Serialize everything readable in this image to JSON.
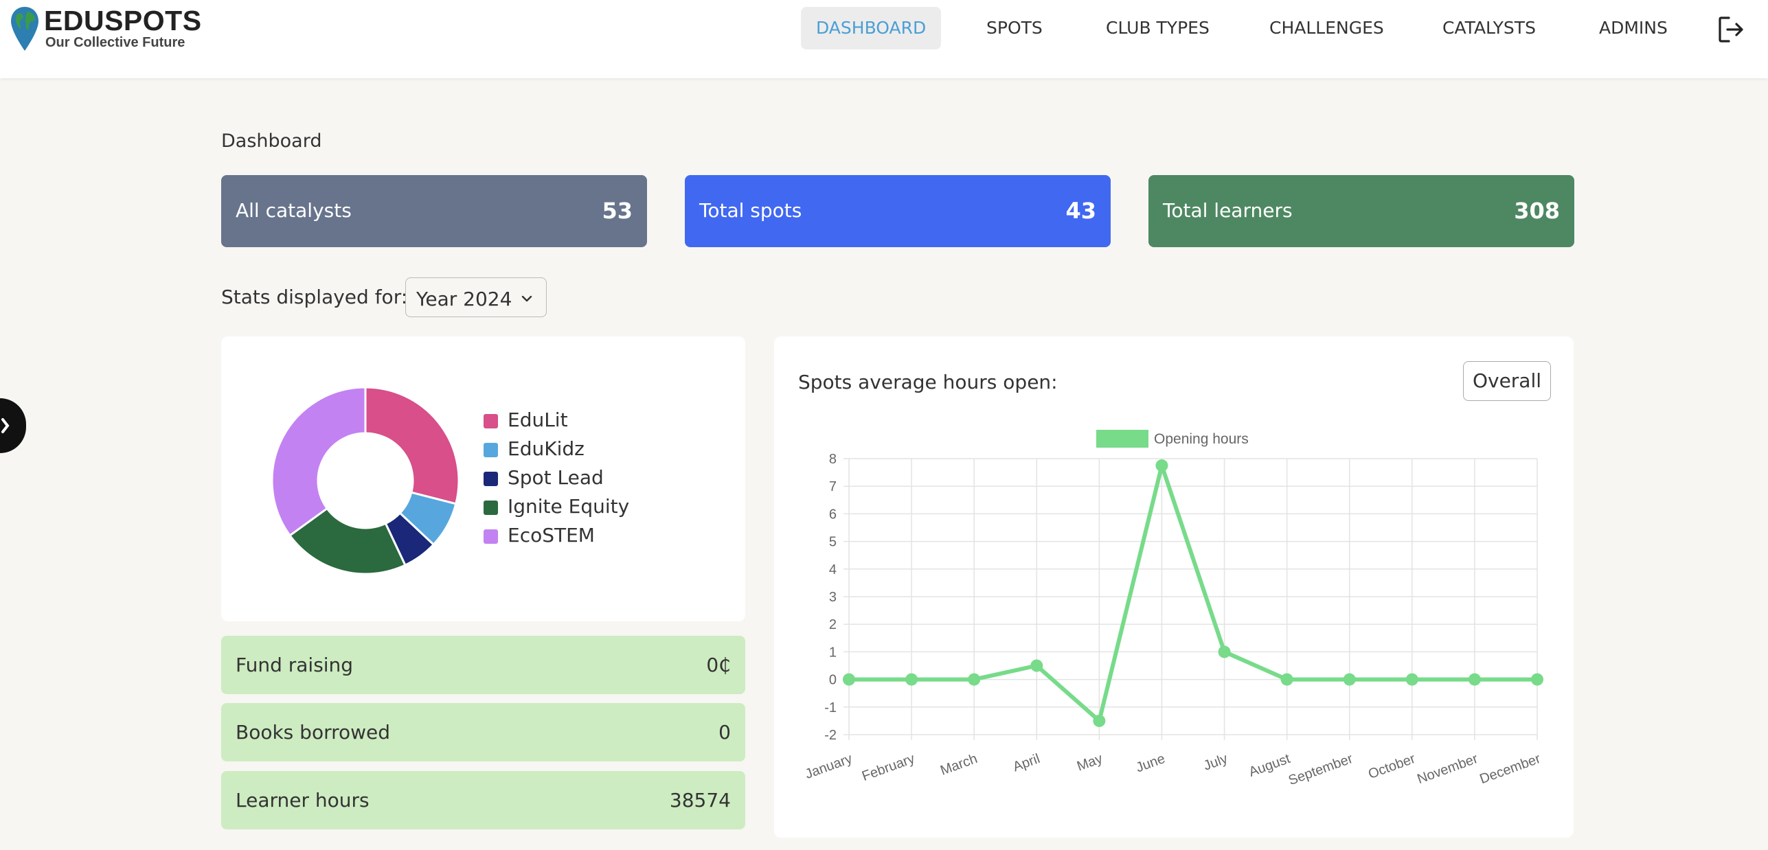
{
  "header": {
    "brand": {
      "name": "EDUSPOTS",
      "tagline": "Our Collective Future"
    },
    "nav": [
      {
        "label": "DASHBOARD",
        "active": true
      },
      {
        "label": "SPOTS",
        "active": false
      },
      {
        "label": "CLUB TYPES",
        "active": false
      },
      {
        "label": "CHALLENGES",
        "active": false
      },
      {
        "label": "CATALYSTS",
        "active": false
      },
      {
        "label": "ADMINS",
        "active": false
      }
    ],
    "logout_icon": "logout-icon"
  },
  "page": {
    "title": "Dashboard"
  },
  "stats": {
    "catalysts": {
      "label": "All catalysts",
      "value": "53",
      "color": "#67748c"
    },
    "spots": {
      "label": "Total spots",
      "value": "43",
      "color": "#4168f1"
    },
    "learners": {
      "label": "Total learners",
      "value": "308",
      "color": "#4e8862"
    }
  },
  "filter": {
    "label": "Stats displayed for:",
    "selected": "Year 2024"
  },
  "club_chart": {
    "type": "doughnut",
    "slices": [
      {
        "name": "EduLit",
        "value": 29,
        "color": "#d84f89"
      },
      {
        "name": "EduKidz",
        "value": 8,
        "color": "#57a7de"
      },
      {
        "name": "Spot Lead",
        "value": 6,
        "color": "#1b2778"
      },
      {
        "name": "Ignite Equity",
        "value": 22,
        "color": "#2a6a3e"
      },
      {
        "name": "EcoSTEM",
        "value": 35,
        "color": "#c382f2"
      }
    ]
  },
  "metrics": [
    {
      "label": "Fund raising",
      "value": "0₵"
    },
    {
      "label": "Books borrowed",
      "value": "0"
    },
    {
      "label": "Learner hours",
      "value": "38574"
    }
  ],
  "hours_panel": {
    "title": "Spots average hours open:",
    "button": "Overall"
  },
  "chart_data": {
    "type": "line",
    "categories": [
      "January",
      "February",
      "March",
      "April",
      "May",
      "June",
      "July",
      "August",
      "September",
      "October",
      "November",
      "December"
    ],
    "series": [
      {
        "name": "Opening hours",
        "values": [
          0,
          0,
          0,
          0.5,
          -1.5,
          7.75,
          1,
          0,
          0,
          0,
          0,
          0
        ],
        "color": "#77db8a"
      }
    ],
    "ylim": [
      -2,
      8
    ],
    "yticks": [
      -2,
      -1,
      0,
      1,
      2,
      3,
      4,
      5,
      6,
      7,
      8
    ],
    "grid": true,
    "legend": "top-center"
  }
}
